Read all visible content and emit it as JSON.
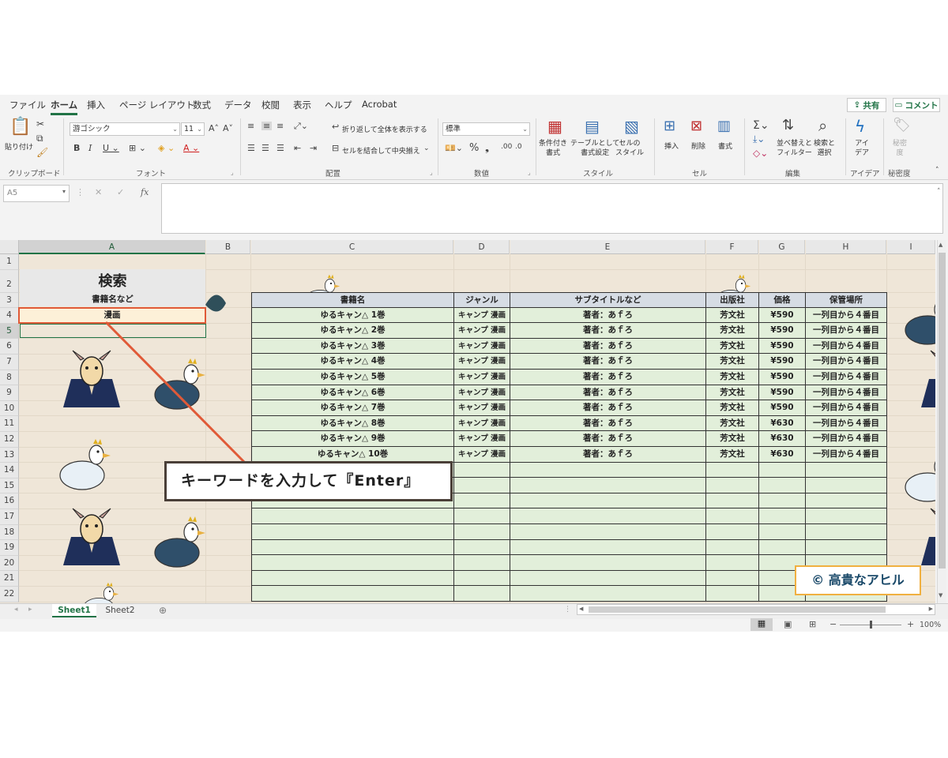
{
  "menu": {
    "tabs": [
      "ファイル",
      "ホーム",
      "挿入",
      "ページ レイアウト",
      "数式",
      "データ",
      "校閲",
      "表示",
      "ヘルプ",
      "Acrobat"
    ],
    "active": "ホーム",
    "share": "共有",
    "comment": "コメント"
  },
  "ribbon": {
    "groups": {
      "clipboard": "クリップボード",
      "font": "フォント",
      "alignment": "配置",
      "number": "数値",
      "styles": "スタイル",
      "cells": "セル",
      "editing": "編集",
      "ideas": "アイデア",
      "sensitivity": "秘密度"
    },
    "paste": "貼り付け",
    "font_name": "游ゴシック",
    "font_size": "11",
    "wrap_text": "折り返して全体を表示する",
    "merge_center": "セルを結合して中央揃え",
    "number_format": "標準",
    "conditional_format": "条件付き\n書式",
    "format_as_table": "テーブルとして\n書式設定",
    "cell_styles": "セルの\nスタイル",
    "insert": "挿入",
    "delete": "削除",
    "format": "書式",
    "sort_filter": "並べ替えと\nフィルター",
    "find_select": "検索と\n選択",
    "ideas_btn": "アイ\nデア",
    "sensitivity_btn": "秘密\n度"
  },
  "formula_bar": {
    "name_box": "A5",
    "fx": "fx",
    "content": ""
  },
  "sheet": {
    "columns": [
      "A",
      "B",
      "C",
      "D",
      "E",
      "F",
      "G",
      "H",
      "I"
    ],
    "rows": [
      "1",
      "2",
      "3",
      "4",
      "5",
      "6",
      "7",
      "8",
      "9",
      "10",
      "11",
      "12",
      "13",
      "14",
      "15",
      "16",
      "17",
      "18",
      "19",
      "20",
      "21",
      "22"
    ],
    "title": "検索",
    "search_label": "書籍名など",
    "search_value": "漫画"
  },
  "table": {
    "headers": [
      "書籍名",
      "ジャンル",
      "サブタイトルなど",
      "出版社",
      "価格",
      "保管場所"
    ],
    "rows": [
      [
        "ゆるキャン△ 1巻",
        "キャンプ 漫画",
        "著者：あｆろ",
        "芳文社",
        "¥590",
        "一列目から４番目"
      ],
      [
        "ゆるキャン△ 2巻",
        "キャンプ 漫画",
        "著者：あｆろ",
        "芳文社",
        "¥590",
        "一列目から４番目"
      ],
      [
        "ゆるキャン△ 3巻",
        "キャンプ 漫画",
        "著者：あｆろ",
        "芳文社",
        "¥590",
        "一列目から４番目"
      ],
      [
        "ゆるキャン△ 4巻",
        "キャンプ 漫画",
        "著者：あｆろ",
        "芳文社",
        "¥590",
        "一列目から４番目"
      ],
      [
        "ゆるキャン△ 5巻",
        "キャンプ 漫画",
        "著者：あｆろ",
        "芳文社",
        "¥590",
        "一列目から４番目"
      ],
      [
        "ゆるキャン△ 6巻",
        "キャンプ 漫画",
        "著者：あｆろ",
        "芳文社",
        "¥590",
        "一列目から４番目"
      ],
      [
        "ゆるキャン△ 7巻",
        "キャンプ 漫画",
        "著者：あｆろ",
        "芳文社",
        "¥590",
        "一列目から４番目"
      ],
      [
        "ゆるキャン△ 8巻",
        "キャンプ 漫画",
        "著者：あｆろ",
        "芳文社",
        "¥630",
        "一列目から４番目"
      ],
      [
        "ゆるキャン△ 9巻",
        "キャンプ 漫画",
        "著者：あｆろ",
        "芳文社",
        "¥630",
        "一列目から４番目"
      ],
      [
        "ゆるキャン△ 10巻",
        "キャンプ 漫画",
        "著者：あｆろ",
        "芳文社",
        "¥630",
        "一列目から４番目"
      ]
    ],
    "empty_rows": 9
  },
  "callout": "キーワードを入力して『Enter』",
  "credit": "© 高貴なアヒル",
  "sheet_tabs": [
    "Sheet1",
    "Sheet2"
  ],
  "active_sheet": "Sheet1",
  "status": {
    "zoom": "100%"
  },
  "colors": {
    "excel_green": "#217346",
    "highlight_border": "#e05a38",
    "table_body": "#e2efda",
    "table_header": "#d6dce4"
  }
}
